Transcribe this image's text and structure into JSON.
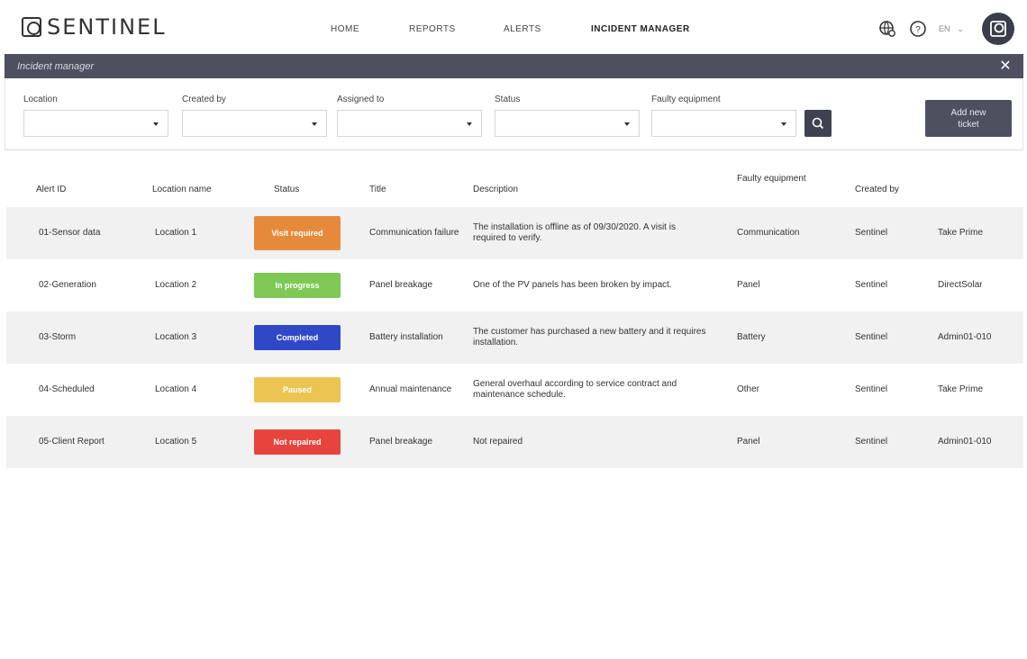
{
  "brand": {
    "name": "SENTINEL"
  },
  "nav": {
    "links": [
      "HOME",
      "REPORTS",
      "ALERTS",
      "INCIDENT MANAGER"
    ],
    "active_index": 3,
    "lang": "EN"
  },
  "panel": {
    "title": "Incident manager"
  },
  "filters": [
    {
      "label": "Location",
      "value": ""
    },
    {
      "label": "Created by",
      "value": ""
    },
    {
      "label": "Assigned to",
      "value": ""
    },
    {
      "label": "Status",
      "value": ""
    },
    {
      "label": "Faulty equipment",
      "value": ""
    }
  ],
  "add_button": {
    "label": "Add new ticket"
  },
  "table": {
    "columns": [
      "Alert ID",
      "Location name",
      "Status",
      "Title",
      "Description",
      "Faulty equipment",
      "Created by",
      ""
    ],
    "rows": [
      {
        "alert_id": "01-Sensor data",
        "location": "Location 1",
        "status": "Visit required",
        "status_color": "#e58a3b",
        "title": "Communication failure",
        "description": "The installation is offline as of 09/30/2020. A visit is required to verify.",
        "equipment": "Communication",
        "created_by": "Sentinel",
        "assigned": "Take Prime"
      },
      {
        "alert_id": "02-Generation",
        "location": "Location 2",
        "status": "In progress",
        "status_color": "#7ec856",
        "title": "Panel breakage",
        "description": "One of the PV panels has been broken by impact.",
        "equipment": "Panel",
        "created_by": "Sentinel",
        "assigned": "DirectSolar"
      },
      {
        "alert_id": "03-Storm",
        "location": "Location 3",
        "status": "Completed",
        "status_color": "#3048c8",
        "title": "Battery installation",
        "description": "The customer has purchased a new battery and it requires installation.",
        "equipment": "Battery",
        "created_by": "Sentinel",
        "assigned": "Admin01-010"
      },
      {
        "alert_id": "04-Scheduled",
        "location": "Location 4",
        "status": "Paused",
        "status_color": "#ebc452",
        "title": "Annual maintenance",
        "description": "General overhaul according to service contract and maintenance schedule.",
        "equipment": "Other",
        "created_by": "Sentinel",
        "assigned": "Take Prime"
      },
      {
        "alert_id": "05-Client Report",
        "location": "Location 5",
        "status": "Not repaired",
        "status_color": "#e6443d",
        "title": "Panel breakage",
        "description": "Not repaired",
        "equipment": "Panel",
        "created_by": "Sentinel",
        "assigned": "Admin01-010"
      }
    ]
  }
}
